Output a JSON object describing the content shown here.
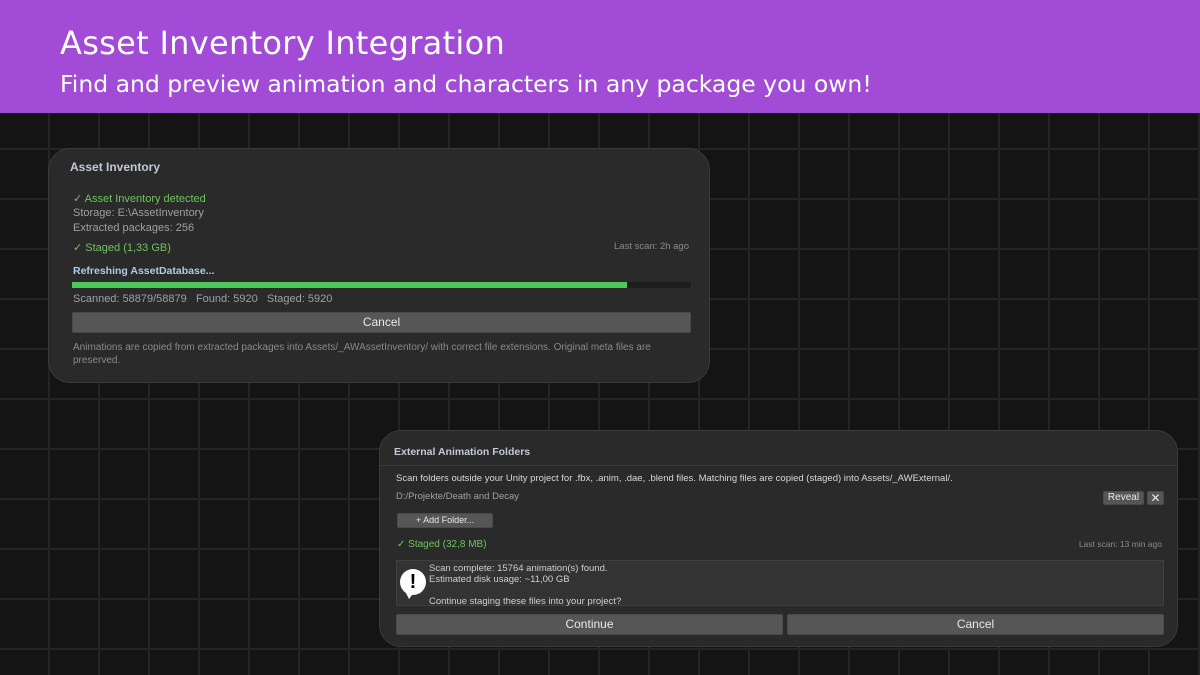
{
  "banner": {
    "title": "Asset Inventory Integration",
    "subtitle": "Find and preview animation and characters in any package you own!",
    "color": "#a24bd7"
  },
  "asset_inventory": {
    "title": "Asset Inventory",
    "detected": "Asset Inventory detected",
    "storage": "Storage: E:\\AssetInventory",
    "extracted": "Extracted packages: 256",
    "staged": "Staged (1,33 GB)",
    "last_scan": "Last scan: 2h ago",
    "status": "Refreshing AssetDatabase...",
    "progress_fraction": 0.897,
    "stats": "Scanned: 58879/58879   Found: 5920   Staged: 5920",
    "cancel_label": "Cancel",
    "footer": "Animations are copied from extracted packages into Assets/_AWAssetInventory/ with correct file extensions. Original meta files are preserved.",
    "check_icon": "check-icon"
  },
  "external_folders": {
    "title": "External Animation Folders",
    "description": "Scan folders outside your Unity project for .fbx, .anim, .dae, .blend files. Matching files are copied (staged) into Assets/_AWExternal/.",
    "folder_path": "D:/Projekte/Death and Decay",
    "reveal_label": "Reveal",
    "remove_icon": "close-icon",
    "add_folder_label": "+ Add Folder...",
    "staged": "Staged (32,8 MB)",
    "last_scan": "Last scan: 13 min ago",
    "notice": {
      "icon": "warning-icon",
      "line1": "Scan complete: 15764 animation(s) found.",
      "line2": "Estimated disk usage: ~11,00 GB",
      "line3": "Continue staging these files into your project?"
    },
    "continue_label": "Continue",
    "cancel_label": "Cancel"
  },
  "colors": {
    "accent_green": "#4cc75a",
    "ok_text": "#6fc45a",
    "panel_bg": "#2a2a2a"
  }
}
